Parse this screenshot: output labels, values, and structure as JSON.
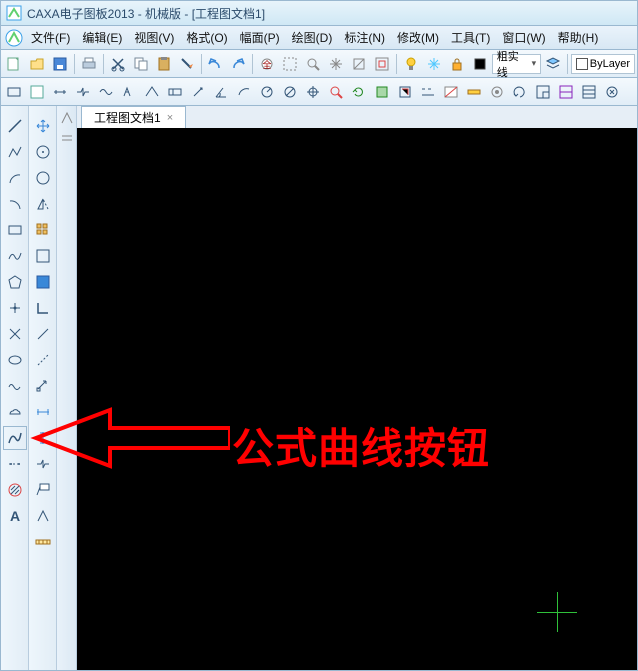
{
  "app": {
    "title": "CAXA电子图板2013 - 机械版 - [工程图文档1]"
  },
  "menu": {
    "items": [
      "文件(F)",
      "编辑(E)",
      "视图(V)",
      "格式(O)",
      "幅面(P)",
      "绘图(D)",
      "标注(N)",
      "修改(M)",
      "工具(T)",
      "窗口(W)",
      "帮助(H)"
    ]
  },
  "toolbar1": {
    "layer_label": "粗实线",
    "layer_dropdown": "ByLayer"
  },
  "doctab": {
    "label": "工程图文档1",
    "close": "×"
  },
  "annotation": {
    "text": "公式曲线按钮"
  },
  "icons": {
    "app": "CAXA",
    "new": "new",
    "open": "open",
    "save": "save",
    "print": "print",
    "cut": "cut",
    "copy": "copy",
    "paste": "paste",
    "undo": "undo",
    "redo": "redo",
    "light": "light",
    "layer": "layer",
    "tri_down": "▾"
  },
  "left_tools": [
    "line",
    "pline",
    "arc",
    "arc2",
    "circle",
    "spline",
    "pentagon",
    "point",
    "cross",
    "hatch",
    "formula-curve",
    "axis",
    "cloud",
    "text"
  ],
  "left_tools2": [
    "move-cross",
    "ortho",
    "mirror",
    "stairs",
    "scale",
    "square-o",
    "square-f",
    "corner",
    "slash",
    "slash2",
    "array",
    "dim",
    "dim2",
    "ruler",
    "break",
    "para",
    "ruler-h"
  ]
}
